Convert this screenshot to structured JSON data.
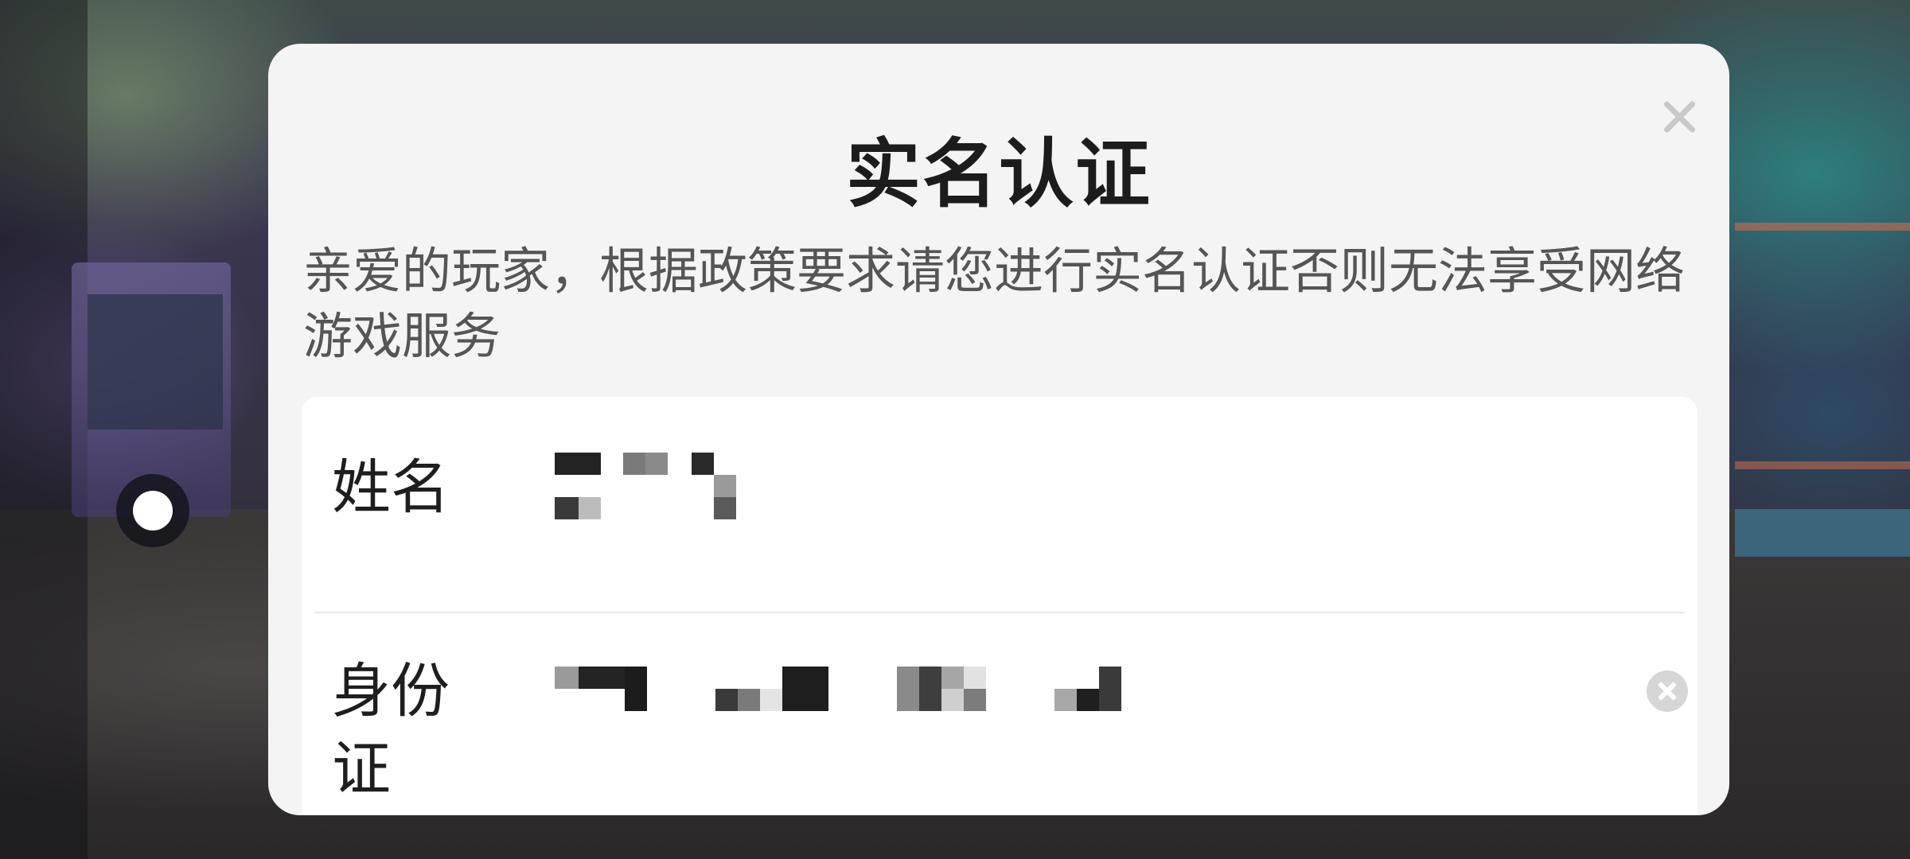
{
  "dialog": {
    "title": "实名认证",
    "description": "亲爱的玩家，根据政策要求请您进行实名认证否则无法享受网络游戏服务",
    "close_icon": "close-icon"
  },
  "form": {
    "name_label": "姓名",
    "name_value": "",
    "id_label": "身份证",
    "id_value": "",
    "clear_icon": "clear-circle-icon"
  },
  "floating_button_icon": "dot-icon",
  "colors": {
    "dialog_bg": "#f4f4f4",
    "card_bg": "#ffffff",
    "title": "#1c1c1c",
    "description": "#555555"
  }
}
